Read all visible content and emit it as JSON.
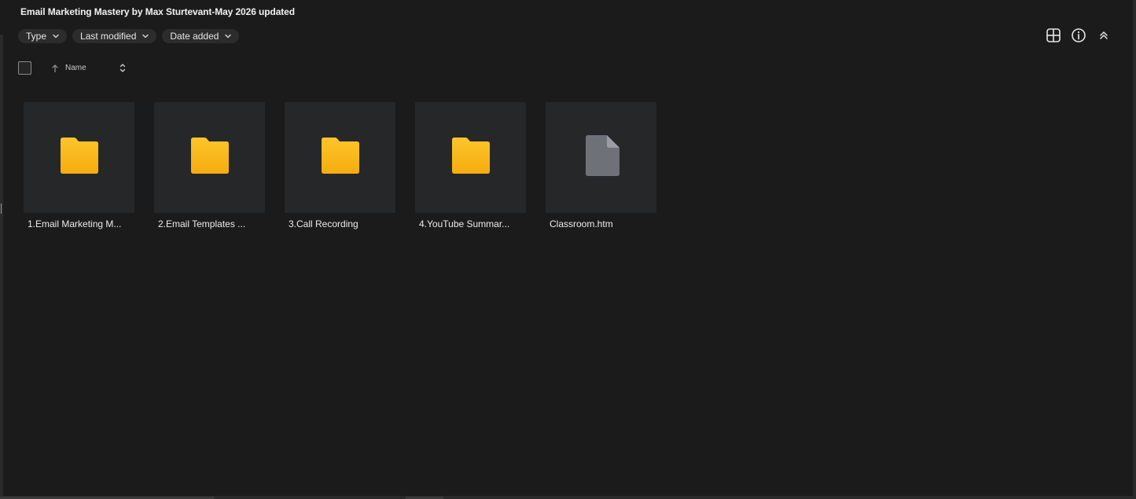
{
  "page": {
    "title": "Email Marketing Mastery by Max Sturtevant-May 2026 updated"
  },
  "filters": [
    {
      "label": "Type"
    },
    {
      "label": "Last modified"
    },
    {
      "label": "Date added"
    }
  ],
  "toolbar": {
    "grid_view_icon": "grid-view-icon",
    "info_icon": "info-icon",
    "collapse_icon": "collapse-up-icon"
  },
  "list_header": {
    "column_name": "Name",
    "sort_direction": "ascending"
  },
  "items": [
    {
      "name": "1.Email Marketing M...",
      "kind": "folder"
    },
    {
      "name": "2.Email Templates ...",
      "kind": "folder"
    },
    {
      "name": "3.Call Recording",
      "kind": "folder"
    },
    {
      "name": "4.YouTube Summar...",
      "kind": "folder"
    },
    {
      "name": "Classroom.htm",
      "kind": "file"
    }
  ],
  "colors": {
    "background": "#1b1b1b",
    "tile": "#262729",
    "folder": "#f9b916",
    "file": "#6e7178",
    "chip": "#2c2c2c"
  }
}
